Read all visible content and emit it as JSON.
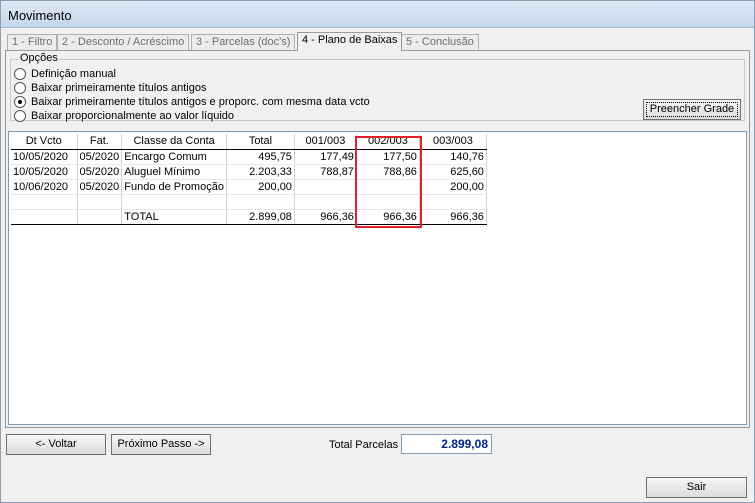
{
  "window": {
    "title": "Movimento"
  },
  "tabs": [
    {
      "label": "1 - Filtro",
      "active": false
    },
    {
      "label": "2 - Desconto / Acréscimo",
      "active": false
    },
    {
      "label": "3 - Parcelas (doc's)",
      "active": false
    },
    {
      "label": "4 - Plano de Baixas",
      "active": true
    },
    {
      "label": "5 - Conclusão",
      "active": false
    }
  ],
  "options": {
    "legend": "Opções",
    "items": [
      {
        "label": "Definição manual",
        "checked": false
      },
      {
        "label": "Baixar primeiramente títulos antigos",
        "checked": false
      },
      {
        "label": "Baixar primeiramente títulos antigos e proporc. com mesma data vcto",
        "checked": true
      },
      {
        "label": "Baixar proporcionalmente ao valor líquido",
        "checked": false
      }
    ]
  },
  "buttons": {
    "fill_grid": "Preencher Grade",
    "back": "<- Voltar",
    "next": "Próximo Passo ->",
    "exit": "Sair"
  },
  "grid": {
    "columns": [
      "Dt Vcto",
      "Fat.",
      "Classe da Conta",
      "Total",
      "001/003",
      "002/003",
      "003/003"
    ],
    "rows": [
      [
        "10/05/2020",
        "05/2020",
        "Encargo Comum",
        "495,75",
        "177,49",
        "177,50",
        "140,76"
      ],
      [
        "10/05/2020",
        "05/2020",
        "Aluguel Mínimo",
        "2.203,33",
        "788,87",
        "788,86",
        "625,60"
      ],
      [
        "10/06/2020",
        "05/2020",
        "Fundo de Promoção",
        "200,00",
        "",
        "",
        "200,00"
      ],
      [
        "",
        "",
        "",
        "",
        "",
        "",
        ""
      ],
      [
        "",
        "",
        "TOTAL",
        "2.899,08",
        "966,36",
        "966,36",
        "966,36"
      ]
    ]
  },
  "footer": {
    "total_label": "Total Parcelas",
    "total_value": "2.899,08"
  },
  "colors": {
    "highlight": "#e0202a",
    "total_value": "#00238c"
  }
}
